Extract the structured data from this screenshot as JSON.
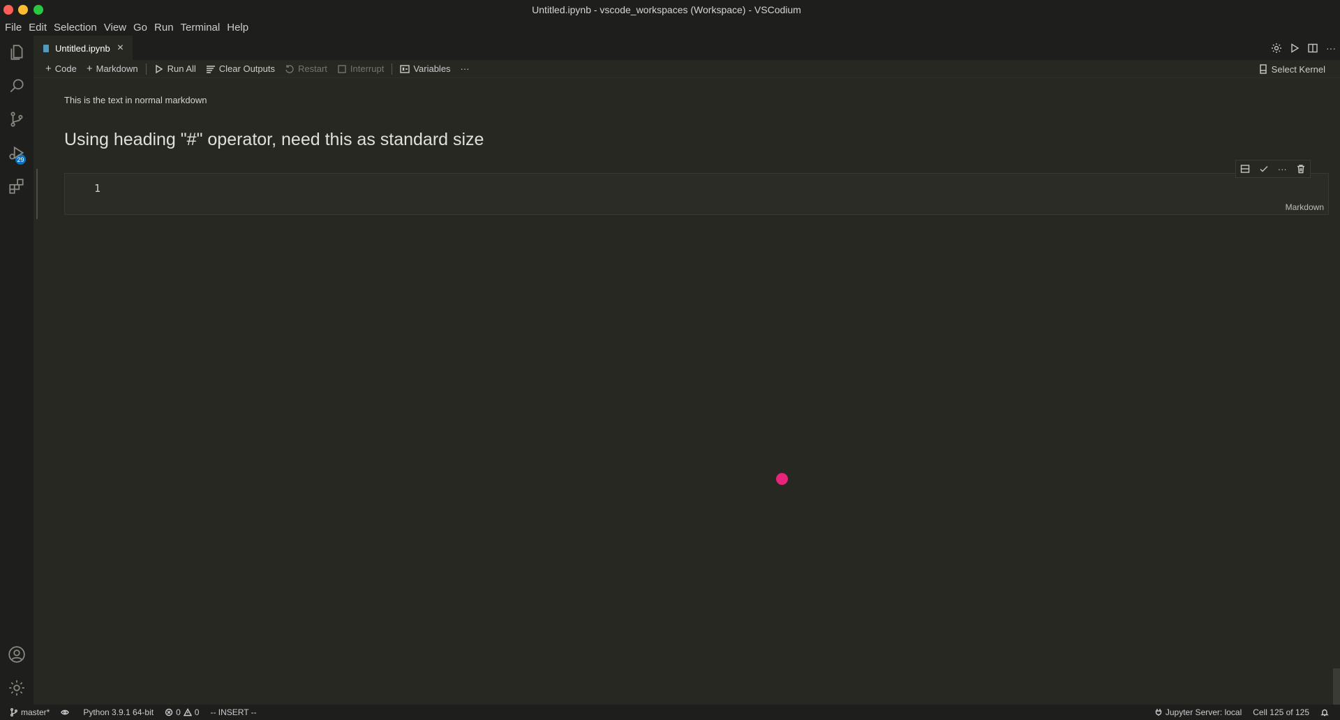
{
  "window": {
    "title": "Untitled.ipynb - vscode_workspaces (Workspace) - VSCodium"
  },
  "menu": [
    "File",
    "Edit",
    "Selection",
    "View",
    "Go",
    "Run",
    "Terminal",
    "Help"
  ],
  "activity_bar": {
    "items": [
      "explorer-icon",
      "search-icon",
      "source-control-icon",
      "run-debug-icon",
      "extensions-icon"
    ],
    "source_control_badge": "29",
    "bottom": [
      "account-icon",
      "manage-gear-icon"
    ]
  },
  "tabs": [
    {
      "label": "Untitled.ipynb",
      "close": "×"
    }
  ],
  "notebook_toolbar": {
    "code": "Code",
    "markdown": "Markdown",
    "run_all": "Run All",
    "clear_outputs": "Clear Outputs",
    "restart": "Restart",
    "interrupt": "Interrupt",
    "variables": "Variables",
    "more": "···",
    "select_kernel": "Select Kernel"
  },
  "cells": {
    "markdown_text": "This is the text in normal markdown",
    "markdown_heading": "Using heading \"#\" operator, need this as standard size",
    "editor": {
      "line_number": "1",
      "language": "Markdown"
    },
    "cell_toolbar_more": "···"
  },
  "statusbar": {
    "branch": "master*",
    "python": "Python 3.9.1 64-bit",
    "errors": "0",
    "warnings": "0",
    "mode": "-- INSERT --",
    "jupyter_server": "Jupyter Server: local",
    "cell_position": "Cell 125 of 125"
  },
  "colors": {
    "background": "#272822",
    "chrome": "#1e1f1c",
    "badge": "#0e70c0",
    "cursor_dot": "#e8237a"
  }
}
